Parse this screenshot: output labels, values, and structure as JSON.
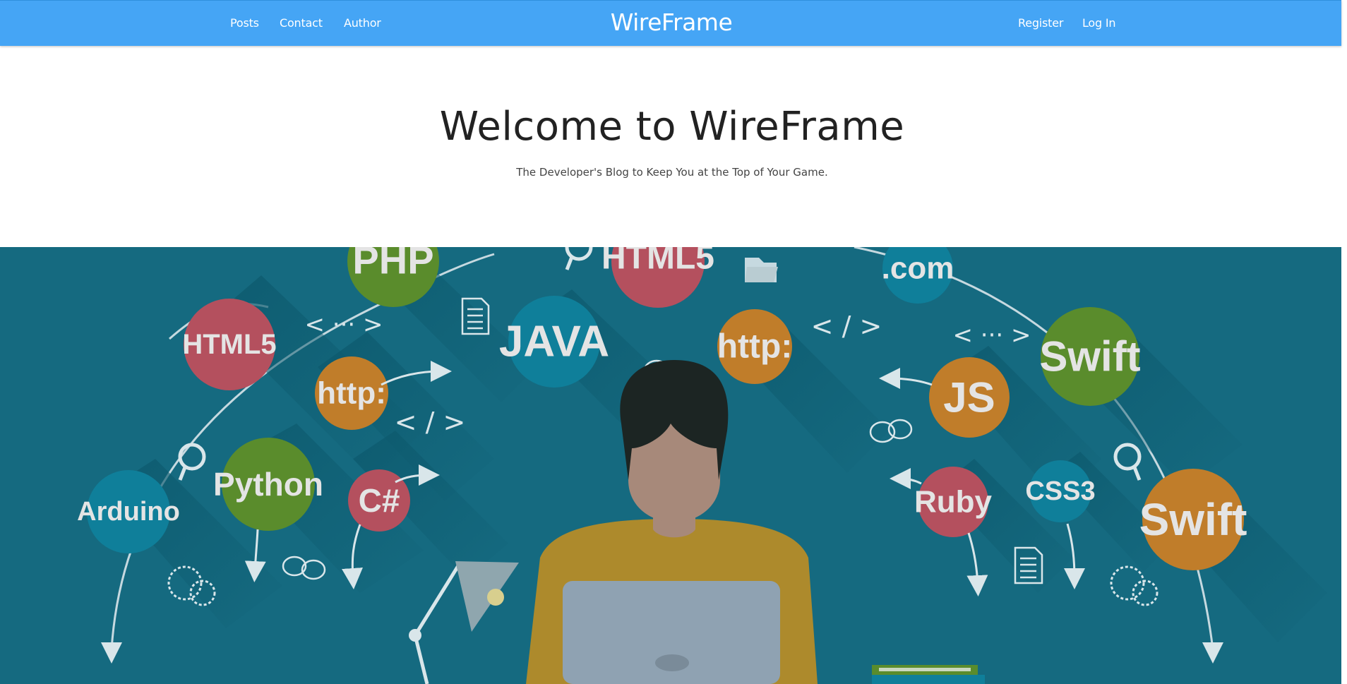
{
  "navbar": {
    "links_left": [
      "Posts",
      "Contact",
      "Author"
    ],
    "brand": "WireFrame",
    "links_right": [
      "Register",
      "Log In"
    ]
  },
  "hero": {
    "title": "Welcome to WireFrame",
    "subtitle": "The Developer's Blog to Keep You at the Top of Your Game."
  },
  "banner": {
    "bubbles": [
      "PHP",
      "HTML5",
      "http:",
      "Python",
      "Arduino",
      "C#",
      "JAVA",
      "HTML5",
      "http:",
      ".com",
      "Swift",
      "JS",
      "Ruby",
      "CSS3",
      "Swift"
    ],
    "code_symbols": [
      "< ··· >",
      "< / >",
      "< / >",
      "< ··· >"
    ]
  },
  "colors": {
    "navbar": "#45a5f5",
    "banner_bg": "#156a80",
    "bubble_red": "#b4505e",
    "bubble_green": "#5a8c2c",
    "bubble_orange": "#c07d2a",
    "bubble_teal": "#0f7f9a"
  },
  "icons": [
    "magnifier-icon",
    "document-icon",
    "folder-icon",
    "chat-bubbles-icon",
    "gear-icon",
    "arrow-icon",
    "lamp-icon",
    "laptop-icon"
  ]
}
